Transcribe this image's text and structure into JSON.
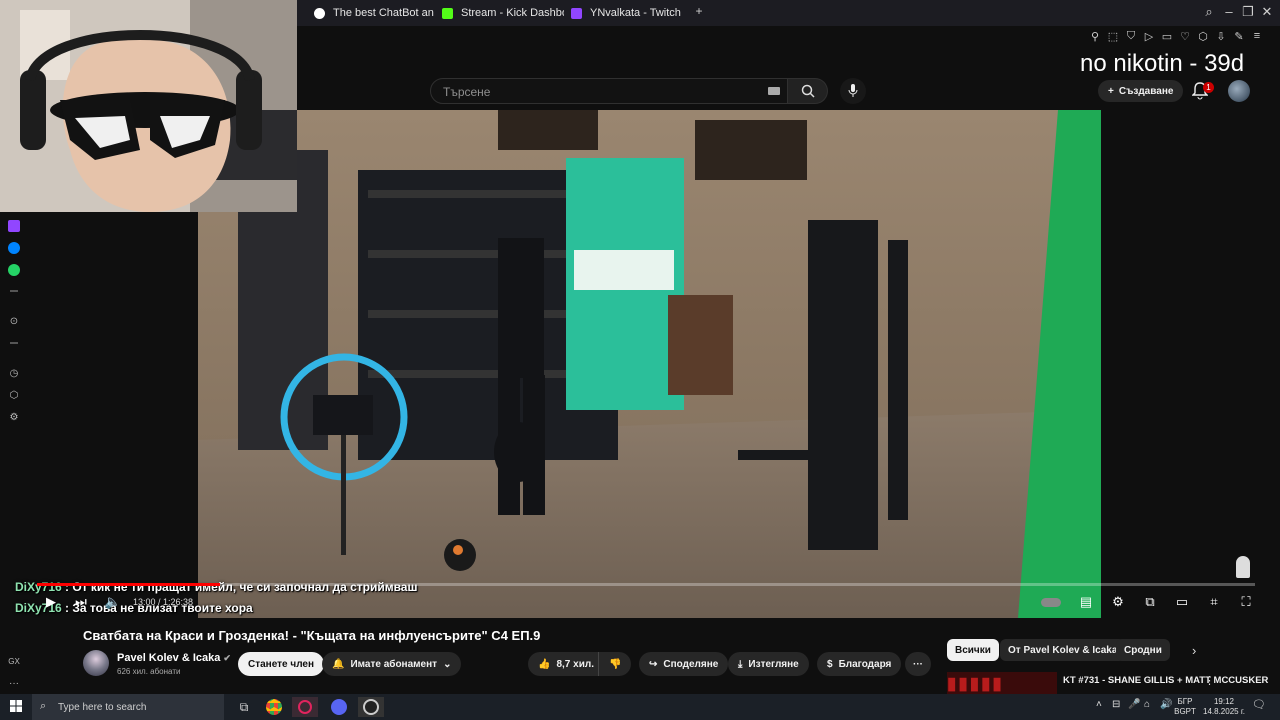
{
  "browser": {
    "tabs": [
      {
        "label": "The best ChatBot and W",
        "icon": "chatbot-icon",
        "color": "#ffffff"
      },
      {
        "label": "Stream - Kick Dashboard",
        "icon": "kick-icon",
        "color": "#53fc18"
      },
      {
        "label": "YNvalkata - Twitch",
        "icon": "twitch-icon",
        "color": "#9146ff"
      }
    ],
    "new_tab": "+"
  },
  "youtube": {
    "search_placeholder": "Търсене",
    "create_label": "Създаване",
    "notification_count": "1"
  },
  "overlay_text": "no nikotin - 39d",
  "player": {
    "time": "13:00 / 1:26:38"
  },
  "chat": [
    {
      "user": "DiXy716",
      "message": " : От кик не ти пращат имейл, че си започнал да стриймваш"
    },
    {
      "user": "DiXy716",
      "message": " : За това не влизат твоите хора"
    }
  ],
  "video": {
    "title": "Сватбата на Краси и Грозденка! - \"Къщата на инфлуенсърите\" С4 ЕП.9",
    "channel": "Pavel Kolev & Icaka",
    "subscribers": "626 хил. абонати",
    "join_label": "Станете член",
    "subscribed_label": "Имате абонамент",
    "likes": "8,7 хил.",
    "share_label": "Споделяне",
    "download_label": "Изтегляне",
    "thanks_label": "Благодаря"
  },
  "filters": [
    "Всички",
    "От Pavel Kolev & Icaka",
    "Сродни"
  ],
  "recommendation": {
    "title": "KT #731 - SHANE GILLIS + MATT MCCUSKER"
  },
  "taskbar": {
    "search_placeholder": "Type here to search",
    "lang_top": "БГР",
    "lang_bottom": "BGPT",
    "time": "19:12",
    "date": "14.8.2025 г."
  }
}
